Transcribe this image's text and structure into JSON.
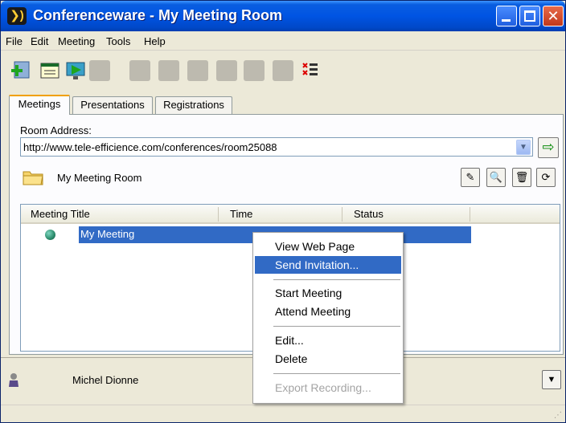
{
  "window": {
    "title": "Conferenceware - My Meeting Room",
    "app_icon_glyph": "❯)"
  },
  "menu": [
    "File",
    "Edit",
    "Meeting",
    "Tools",
    "Help"
  ],
  "tabs": [
    "Meetings",
    "Presentations",
    "Registrations"
  ],
  "room": {
    "label": "Room Address:",
    "address": "http://www.tele-efficience.com/conferences/room25088",
    "folder_name": "My Meeting Room"
  },
  "list": {
    "columns": [
      "Meeting Title",
      "Time",
      "Status"
    ],
    "rows": [
      {
        "title": "My Meeting",
        "time": "",
        "status": ""
      }
    ]
  },
  "context_menu": {
    "items": [
      {
        "label": "View Web Page"
      },
      {
        "label": "Send Invitation..."
      },
      {
        "label": "Start Meeting"
      },
      {
        "label": "Attend Meeting"
      },
      {
        "label": "Edit..."
      },
      {
        "label": "Delete"
      },
      {
        "label": "Export Recording..."
      }
    ]
  },
  "user": {
    "name": "Michel Dionne"
  },
  "colors": {
    "titlebar": "#0054e3",
    "selection": "#316ac5",
    "window_bg": "#ece9d8"
  }
}
